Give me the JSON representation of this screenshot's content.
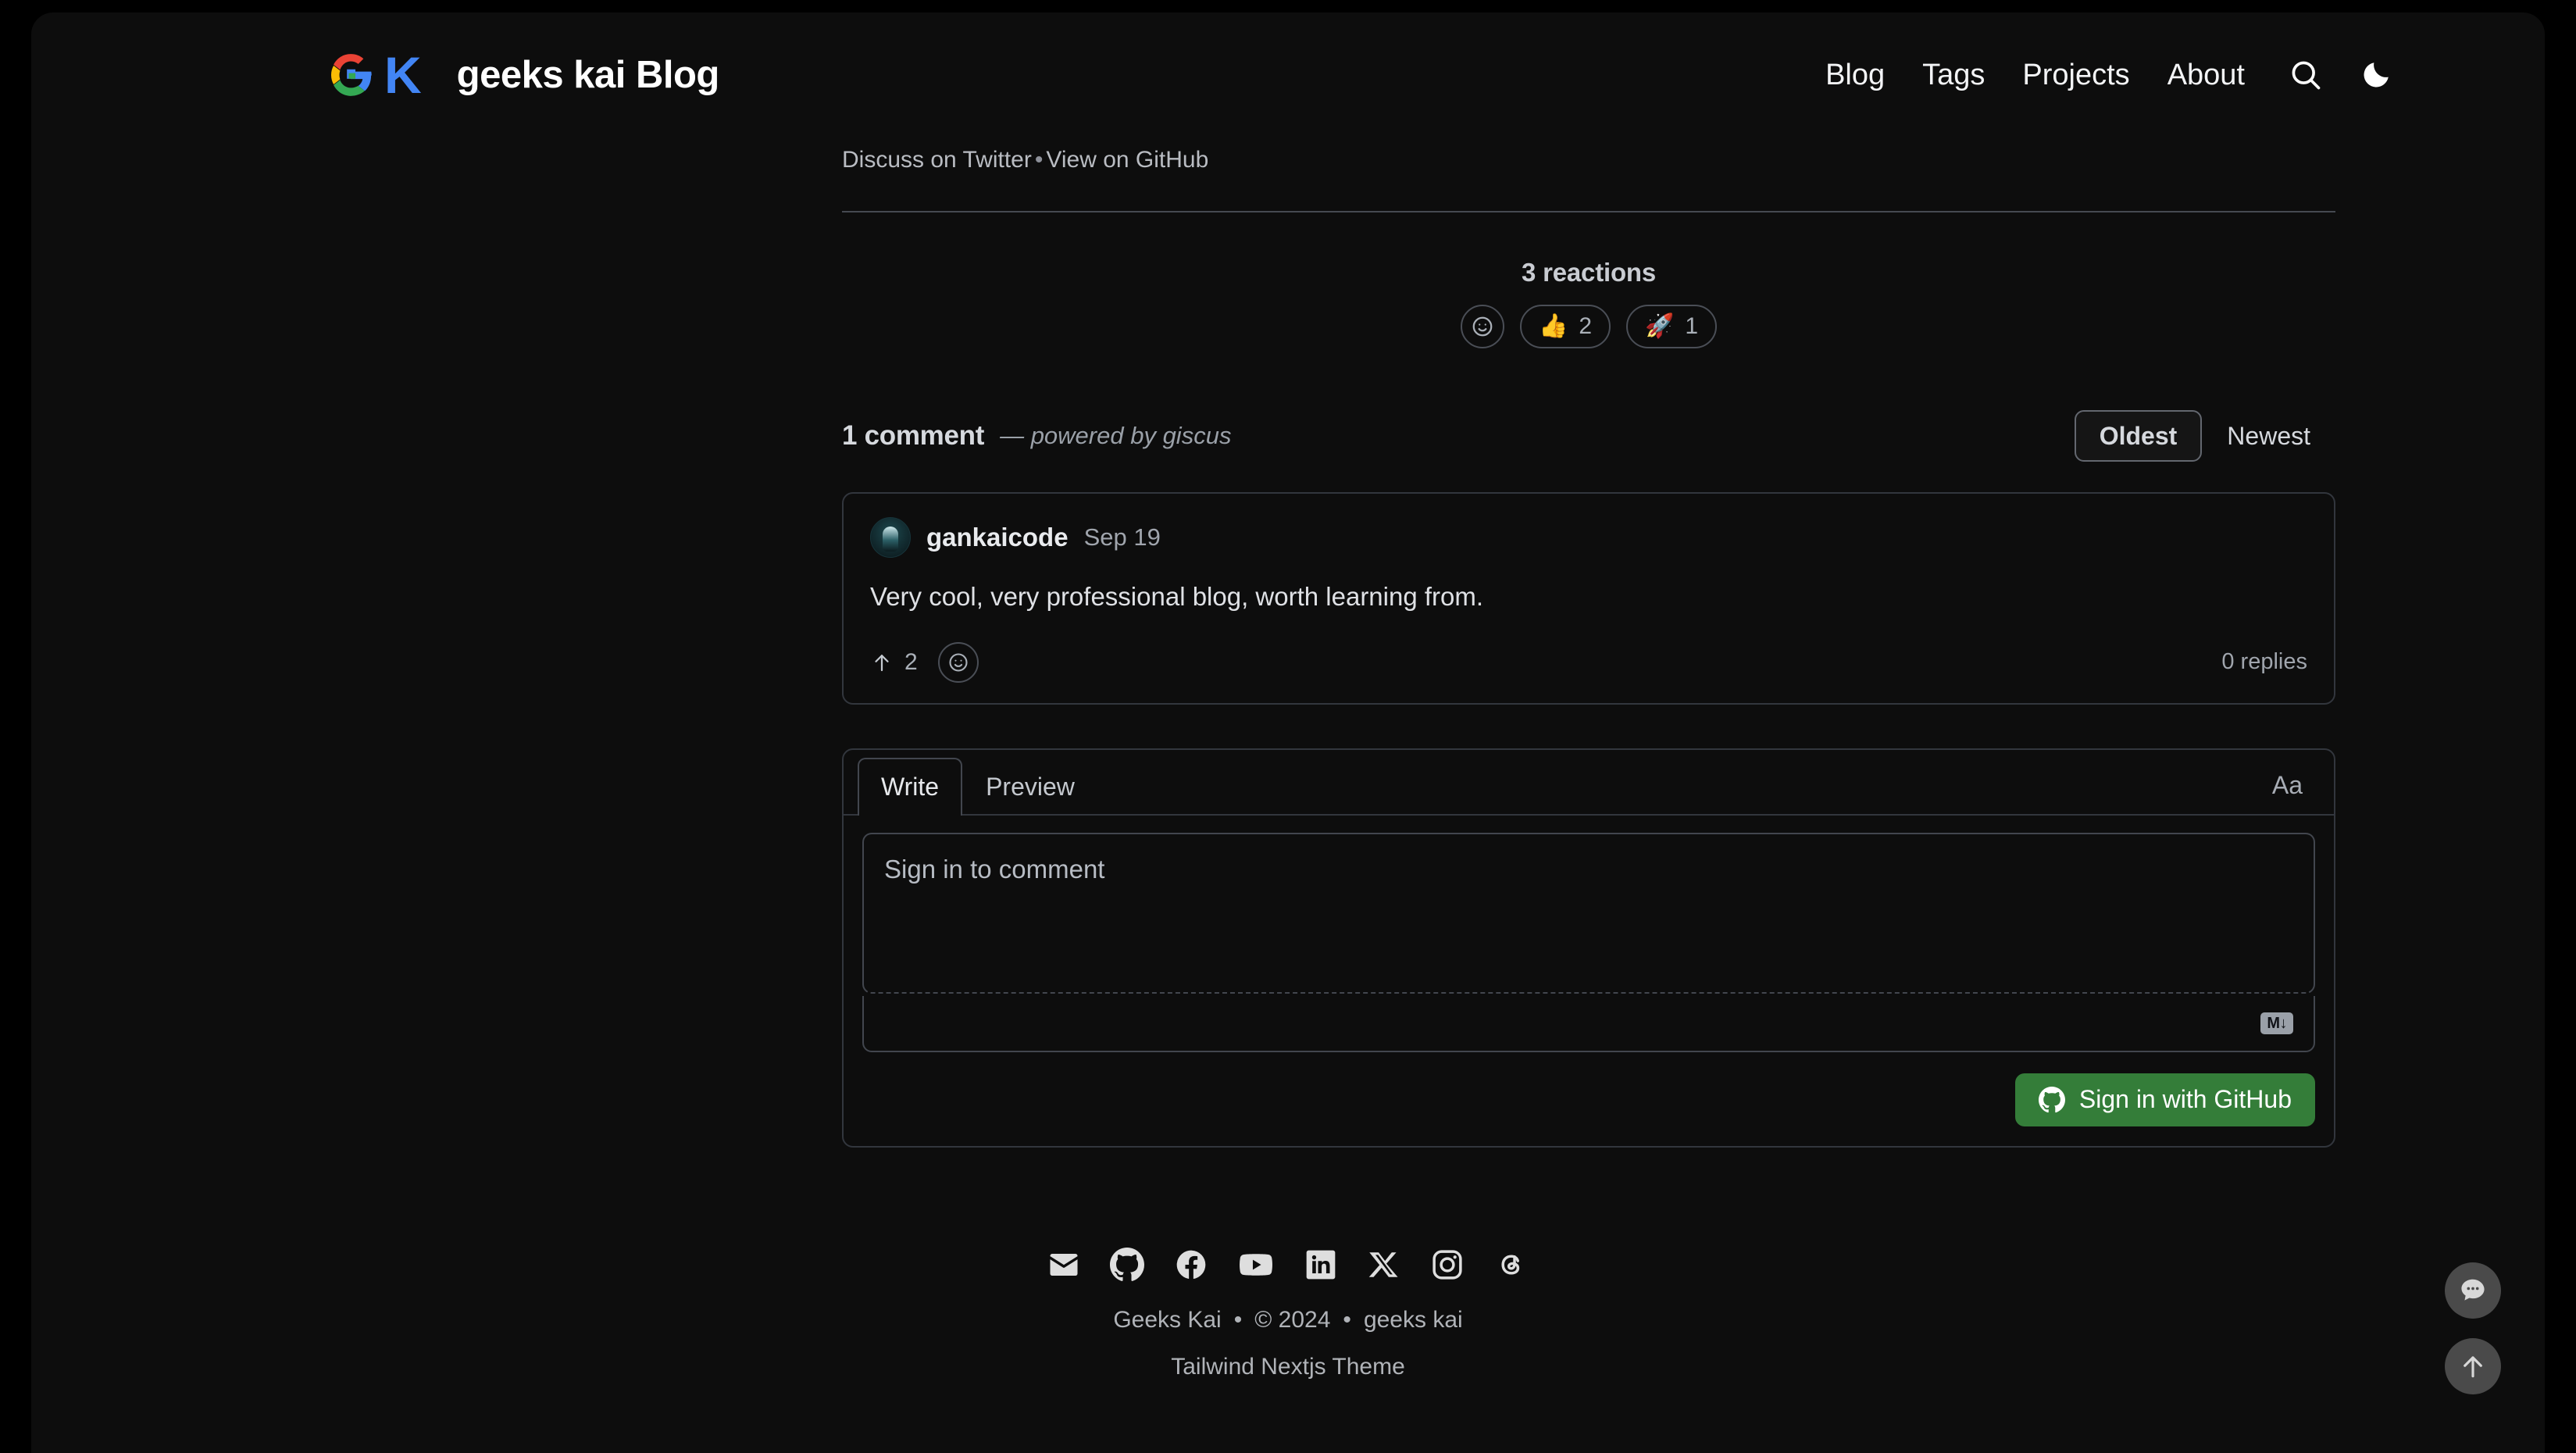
{
  "header": {
    "brand_title": "geeks kai Blog",
    "logo_letter": "K",
    "nav": [
      {
        "label": "Blog"
      },
      {
        "label": "Tags"
      },
      {
        "label": "Projects"
      },
      {
        "label": "About"
      }
    ],
    "search_icon": "search-icon",
    "theme_icon": "moon-icon"
  },
  "post_links": {
    "discuss": "Discuss on Twitter",
    "separator": "•",
    "view": "View on GitHub"
  },
  "reactions": {
    "title": "3 reactions",
    "add_label": "add-reaction",
    "items": [
      {
        "emoji": "👍",
        "count": "2",
        "name": "thumbs-up"
      },
      {
        "emoji": "🚀",
        "count": "1",
        "name": "rocket"
      }
    ]
  },
  "comments": {
    "count_label": "1 comment",
    "powered_by": "— powered by giscus",
    "sort": {
      "oldest": "Oldest",
      "newest": "Newest",
      "active": "Oldest"
    },
    "list": [
      {
        "author": "gankaicode",
        "date": "Sep 19",
        "body": "Very cool, very professional blog, worth learning from.",
        "upvotes": "2",
        "replies": "0 replies"
      }
    ]
  },
  "composer": {
    "tabs": [
      {
        "label": "Write",
        "active": true
      },
      {
        "label": "Preview",
        "active": false
      }
    ],
    "font_toggle": "Aa",
    "placeholder": "Sign in to comment",
    "value": "",
    "markdown_badge": "M↓",
    "signin_label": "Sign in with GitHub",
    "signin_color": "#347d39"
  },
  "footer": {
    "socials": [
      {
        "name": "mail-icon"
      },
      {
        "name": "github-icon"
      },
      {
        "name": "facebook-icon"
      },
      {
        "name": "youtube-icon"
      },
      {
        "name": "linkedin-icon"
      },
      {
        "name": "x-icon"
      },
      {
        "name": "instagram-icon"
      },
      {
        "name": "threads-icon"
      }
    ],
    "line1": {
      "site_name": "Geeks Kai",
      "dot1": "•",
      "copyright": "© 2024",
      "dot2": "•",
      "author": "geeks kai"
    },
    "line2": "Tailwind Nextjs Theme"
  },
  "floating": {
    "chat_icon": "comment-bubble-icon",
    "scroll_top_icon": "arrow-up-icon"
  }
}
